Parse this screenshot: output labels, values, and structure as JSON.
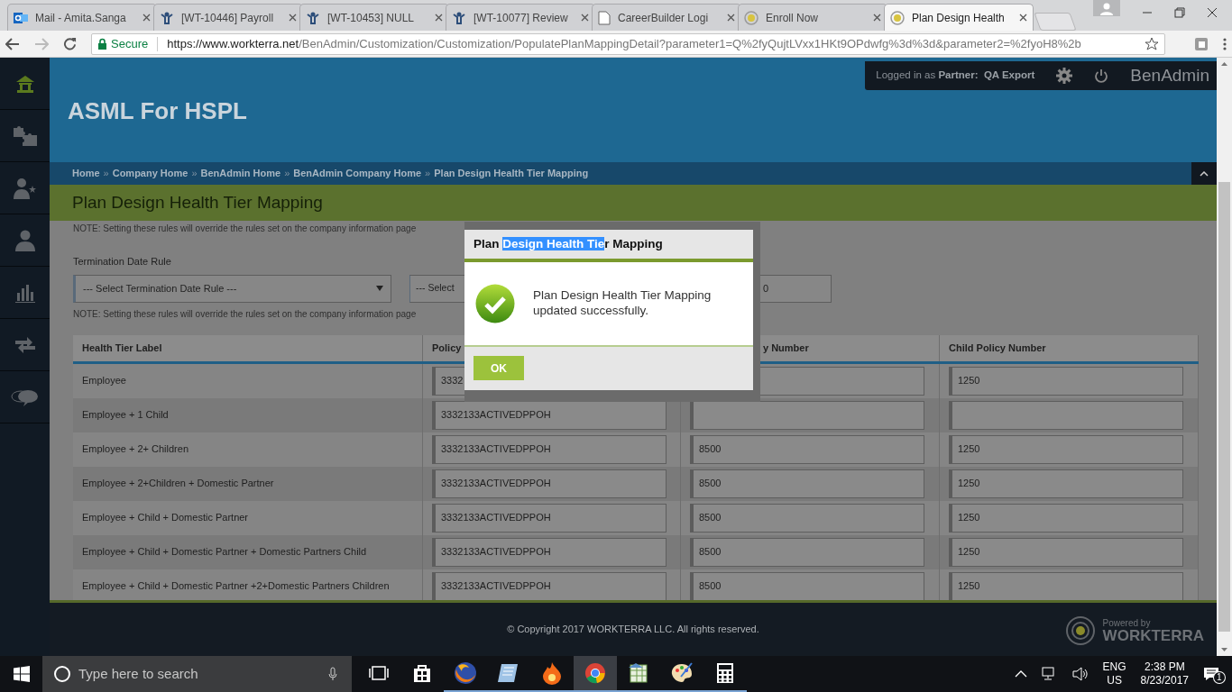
{
  "browser": {
    "tabs": [
      {
        "label": "Mail - Amita.Sanga",
        "kind": "mail",
        "selected": false
      },
      {
        "label": "[WT-10446] Payroll",
        "kind": "tracker",
        "selected": false
      },
      {
        "label": "[WT-10453] NULL",
        "kind": "tracker",
        "selected": false
      },
      {
        "label": "[WT-10077] Review",
        "kind": "tracker",
        "selected": false
      },
      {
        "label": "CareerBuilder Logi",
        "kind": "page",
        "selected": false
      },
      {
        "label": "Enroll Now",
        "kind": "target",
        "selected": false
      },
      {
        "label": "Plan Design Health",
        "kind": "target",
        "selected": true
      }
    ],
    "address": {
      "secure_label": "Secure",
      "url_host": "https://www.workterra.net",
      "url_path": "/BenAdmin/Customization/Customization/PopulatePlanMappingDetail?parameter1=Q%2fyQujtLVxx1HKt9OPdwfg%3d%3d&parameter2=%2fyoH8%2b"
    }
  },
  "sidebar": {
    "items": [
      {
        "kind": "home",
        "selected": true
      },
      {
        "kind": "puzzle",
        "selected": false
      },
      {
        "kind": "person-star",
        "selected": false
      },
      {
        "kind": "person",
        "selected": false
      },
      {
        "kind": "chart",
        "selected": false
      },
      {
        "kind": "arrows",
        "selected": false
      },
      {
        "kind": "chat",
        "selected": false
      }
    ]
  },
  "header": {
    "company": "ASML For HSPL",
    "logged_in_prefix": "Logged in as",
    "logged_in_role": "Partner:",
    "logged_in_name": "QA Export",
    "app_name": "BenAdmin"
  },
  "breadcrumbs": {
    "separator": "»",
    "items": [
      "Home",
      "Company Home",
      "BenAdmin Home",
      "BenAdmin Company Home",
      "Plan Design Health Tier Mapping"
    ]
  },
  "page_title": "Plan Design Health Tier Mapping",
  "note_top": "NOTE: Setting these rules will override the rules set on the company information page",
  "termination": {
    "label": "Termination Date Rule",
    "select_placeholder": "--- Select Termination Date Rule ---",
    "second_select": "--- Select",
    "third_field": "0"
  },
  "note_bottom": "NOTE: Setting these rules will override the rules set on the company information page",
  "table": {
    "columns": [
      "Health Tier Label",
      "Policy",
      "y Number",
      "Child Policy Number"
    ],
    "rows": [
      {
        "cells": [
          "Employee",
          "3332",
          null,
          "1250"
        ]
      },
      {
        "cells": [
          "Employee + 1 Child",
          "3332133ACTIVEDPPOH",
          null,
          null
        ]
      },
      {
        "cells": [
          "Employee + 2+ Children",
          "3332133ACTIVEDPPOH",
          "8500",
          "1250"
        ]
      },
      {
        "cells": [
          "Employee + 2+Children + Domestic Partner",
          "3332133ACTIVEDPPOH",
          "8500",
          "1250"
        ]
      },
      {
        "cells": [
          "Employee + Child + Domestic Partner",
          "3332133ACTIVEDPPOH",
          "8500",
          "1250"
        ]
      },
      {
        "cells": [
          "Employee + Child + Domestic Partner + Domestic Partners Child",
          "3332133ACTIVEDPPOH",
          "8500",
          "1250"
        ]
      },
      {
        "cells": [
          "Employee + Child + Domestic Partner +2+Domestic Partners Children",
          "3332133ACTIVEDPPOH",
          "8500",
          "1250"
        ]
      }
    ]
  },
  "dialog": {
    "title_parts": [
      {
        "text": "Plan ",
        "highlighted": false
      },
      {
        "text": "Design Health Tie",
        "highlighted": true
      },
      {
        "text": "r Mapping",
        "highlighted": false
      }
    ],
    "message": "Plan Design Health Tier Mapping updated successfully.",
    "ok_button": "OK"
  },
  "footer": {
    "copyright": "© Copyright 2017 WORKTERRA LLC. All rights reserved.",
    "powered_by": "Powered by",
    "brand": "WORKTERRA"
  },
  "taskbar": {
    "search_placeholder": "Type here to search",
    "apps": [
      {
        "kind": "task-view",
        "running": false,
        "selected": false
      },
      {
        "kind": "store",
        "running": false,
        "selected": false
      },
      {
        "kind": "firefox",
        "running": true,
        "selected": false
      },
      {
        "kind": "notepad",
        "running": true,
        "selected": false
      },
      {
        "kind": "flame",
        "running": true,
        "selected": false
      },
      {
        "kind": "chrome",
        "running": true,
        "selected": true
      },
      {
        "kind": "spreadsheet",
        "running": true,
        "selected": false
      },
      {
        "kind": "paint",
        "running": true,
        "selected": false
      },
      {
        "kind": "calculator",
        "running": true,
        "selected": false
      }
    ],
    "language": "ENG",
    "region": "US",
    "time": "2:38 PM",
    "date": "8/23/2017",
    "notifications": "1"
  }
}
